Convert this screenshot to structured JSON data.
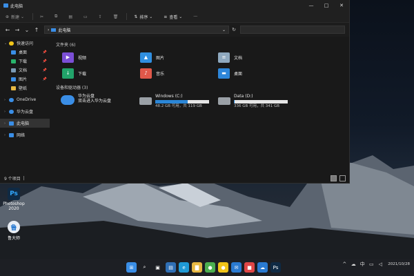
{
  "window": {
    "title": "此电脑",
    "controls": [
      "—",
      "□",
      "✕"
    ]
  },
  "toolbar": {
    "new_label": "新建",
    "sort_label": "排序",
    "view_label": "查看",
    "more_label": "···"
  },
  "address": {
    "path": "此电脑",
    "nav": [
      "←",
      "→",
      "⌄",
      "↑"
    ]
  },
  "sidebar": {
    "items": [
      {
        "label": "快速访问",
        "icon": "star-icon",
        "color": "#f0c419",
        "level": 0,
        "expanded": true
      },
      {
        "label": "桌面",
        "icon": "desktop-icon",
        "color": "#3a8ee6",
        "level": 1,
        "pinned": true
      },
      {
        "label": "下载",
        "icon": "download-icon",
        "color": "#29b36b",
        "level": 1,
        "pinned": true
      },
      {
        "label": "文档",
        "icon": "document-icon",
        "color": "#7a9ab5",
        "level": 1,
        "pinned": true
      },
      {
        "label": "图片",
        "icon": "picture-icon",
        "color": "#3a8ee6",
        "level": 1,
        "pinned": true
      },
      {
        "label": "壁纸",
        "icon": "folder-icon",
        "color": "#e7b843",
        "level": 1,
        "pinned": false
      },
      {
        "label": "OneDrive",
        "icon": "onedrive-icon",
        "color": "#3a8ee6",
        "level": 0
      },
      {
        "label": "华为云盘",
        "icon": "cloud-icon",
        "color": "#3a8ee6",
        "level": 0
      },
      {
        "label": "此电脑",
        "icon": "pc-icon",
        "color": "#3a8ee6",
        "level": 0,
        "selected": true
      },
      {
        "label": "网络",
        "icon": "network-icon",
        "color": "#3a8ee6",
        "level": 0
      }
    ]
  },
  "main": {
    "folders_header": "文件夹 (6)",
    "folders": [
      {
        "label": "视频",
        "icon": "video-folder-icon",
        "color": "#7b4fd6"
      },
      {
        "label": "图片",
        "icon": "pictures-folder-icon",
        "color": "#2f8fe0"
      },
      {
        "label": "文档",
        "icon": "documents-folder-icon",
        "color": "#8fa9bf"
      },
      {
        "label": "下载",
        "icon": "downloads-folder-icon",
        "color": "#22a36a"
      },
      {
        "label": "音乐",
        "icon": "music-folder-icon",
        "color": "#e0584a"
      },
      {
        "label": "桌面",
        "icon": "desktop-folder-icon",
        "color": "#2d86d9"
      }
    ],
    "devices_header": "设备和驱动器 (3)",
    "cloud": {
      "name": "华为云盘",
      "desc": "双击进入华为云盘"
    },
    "drives": [
      {
        "name": "Windows (C:)",
        "free": "48.2 GB 可用，共 119 GB",
        "used_fraction": 0.6
      },
      {
        "name": "Data (D:)",
        "free": "336 GB 可用，共 341 GB",
        "used_fraction": 0.015
      }
    ]
  },
  "status": {
    "count": "9 个项目",
    "divider": "|"
  },
  "desktop": {
    "icons": [
      {
        "label1": "Photoshop",
        "label2": "2020",
        "glyph": "Ps"
      },
      {
        "label1": "鲁大师",
        "label2": "",
        "glyph": "鲁"
      }
    ]
  },
  "taskbar": {
    "apps": [
      {
        "name": "start-icon",
        "glyph": "⊞",
        "color": "#3a8ee6"
      },
      {
        "name": "search-icon",
        "glyph": "⌕",
        "color": "#1d1f24"
      },
      {
        "name": "taskview-icon",
        "glyph": "▣",
        "color": "#1d1f24"
      },
      {
        "name": "widgets-icon",
        "glyph": "▤",
        "color": "#2f6fb5"
      },
      {
        "name": "edge-icon",
        "glyph": "e",
        "color": "#1f9ad6"
      },
      {
        "name": "explorer-icon",
        "glyph": "▇",
        "color": "#e7b843"
      },
      {
        "name": "app-green-icon",
        "glyph": "●",
        "color": "#4caf50"
      },
      {
        "name": "app-yellow-icon",
        "glyph": "●",
        "color": "#f0c419"
      },
      {
        "name": "mail-icon",
        "glyph": "✉",
        "color": "#2a7ad1"
      },
      {
        "name": "app-red-icon",
        "glyph": "■",
        "color": "#e04646"
      },
      {
        "name": "cloud-app-icon",
        "glyph": "☁",
        "color": "#2a7ad1"
      },
      {
        "name": "photoshop-icon",
        "glyph": "Ps",
        "color": "#0f2a44"
      }
    ],
    "tray": {
      "chevron": "^",
      "lang": "中",
      "date": "2021/10/28"
    }
  }
}
